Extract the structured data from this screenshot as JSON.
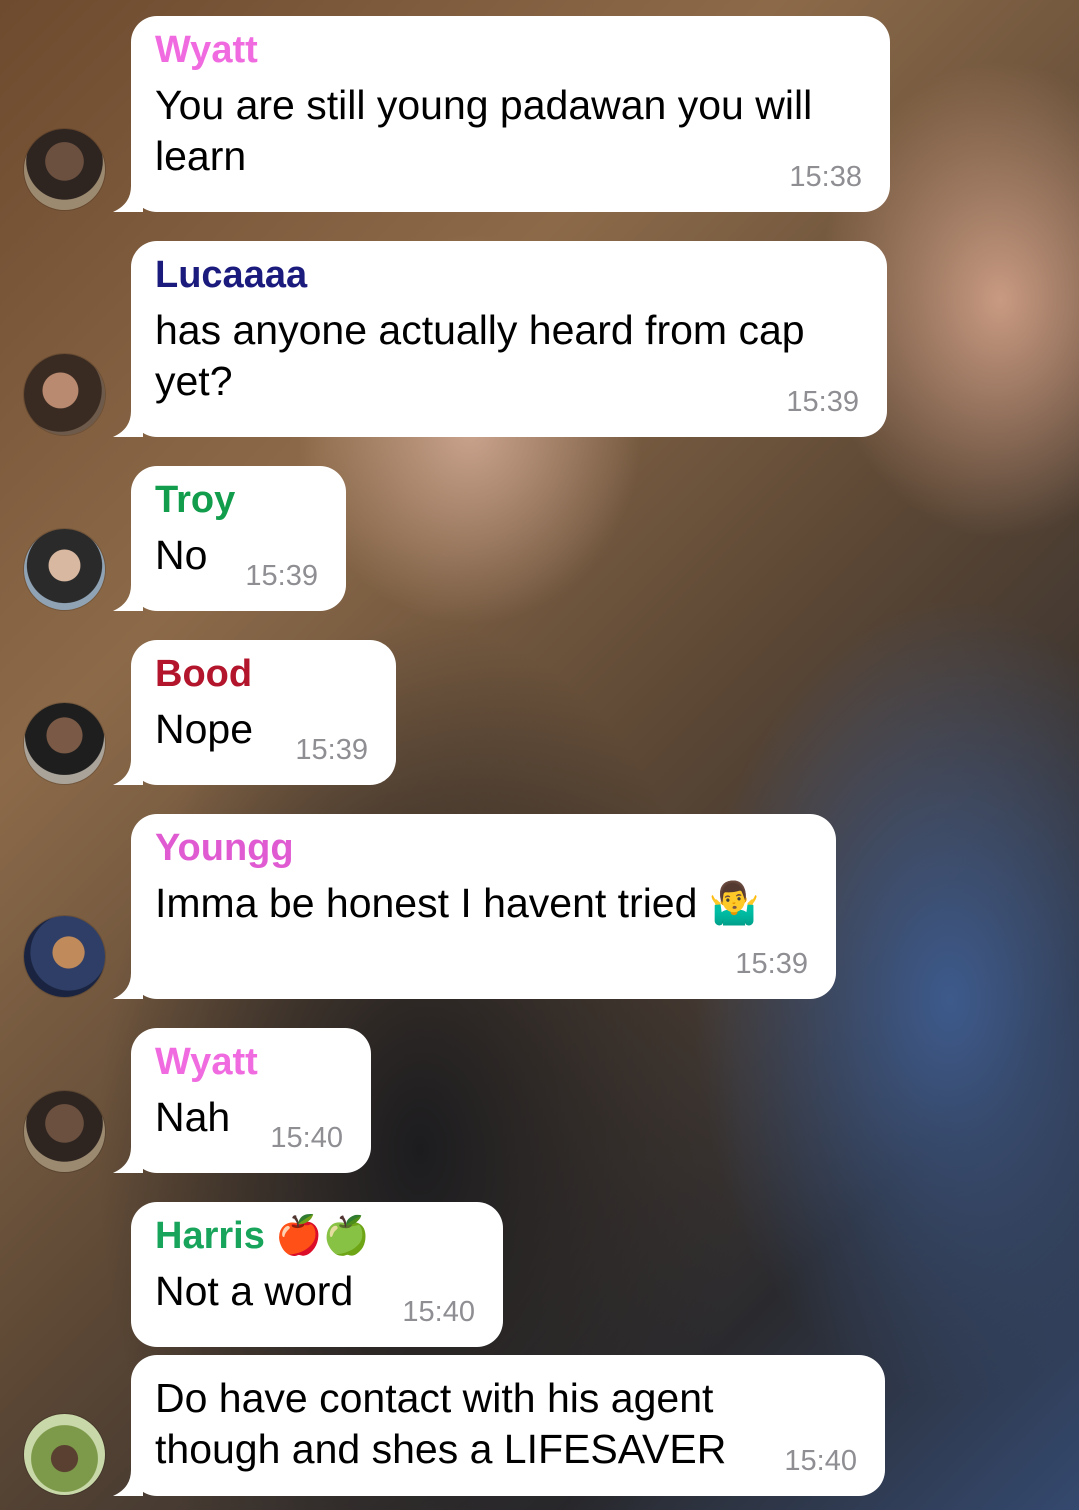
{
  "messages": [
    {
      "sender": "Wyatt",
      "sender_color": "#f06bdf",
      "text": "You are still young padawan you will learn",
      "time": "15:38",
      "avatar": "avatar-wyatt"
    },
    {
      "sender": "Lucaaaa",
      "sender_color": "#1b1b7e",
      "text": "has anyone actually heard from cap yet?",
      "time": "15:39",
      "avatar": "avatar-lucaaaa"
    },
    {
      "sender": "Troy",
      "sender_color": "#119d4c",
      "text": "No",
      "time": "15:39",
      "avatar": "avatar-troy"
    },
    {
      "sender": "Bood",
      "sender_color": "#b3152c",
      "text": "Nope",
      "time": "15:39",
      "avatar": "avatar-bood"
    },
    {
      "sender": "Youngg",
      "sender_color": "#e05bd2",
      "text": "Imma be honest I havent tried 🤷‍♂️",
      "time": "15:39",
      "avatar": "avatar-youngg"
    },
    {
      "sender": "Wyatt",
      "sender_color": "#f06bdf",
      "text": "Nah",
      "time": "15:40",
      "avatar": "avatar-wyatt"
    },
    {
      "sender": "Harris 🍎🍏",
      "sender_color": "#18a55b",
      "text": "Not a word",
      "time": "15:40",
      "avatar": "avatar-harris"
    },
    {
      "sender": "",
      "sender_color": "",
      "text": "Do have contact with his agent though and shes a LIFESAVER",
      "time": "15:40",
      "avatar": "avatar-harris"
    }
  ]
}
